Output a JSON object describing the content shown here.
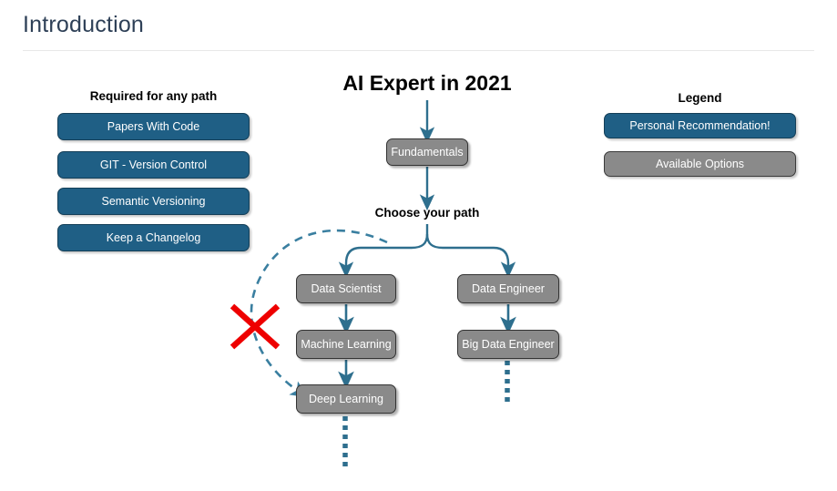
{
  "page": {
    "title": "Introduction"
  },
  "required_section": {
    "heading": "Required for any path",
    "items": [
      {
        "label": "Papers With Code"
      },
      {
        "label": "GIT - Version Control"
      },
      {
        "label": "Semantic Versioning"
      },
      {
        "label": "Keep a Changelog"
      }
    ]
  },
  "legend": {
    "heading": "Legend",
    "items": [
      {
        "label": "Personal Recommendation!",
        "style": "blue",
        "color": "#1f5f85"
      },
      {
        "label": "Available Options",
        "style": "gray",
        "color": "#8a8a8a"
      }
    ]
  },
  "diagram": {
    "title": "AI Expert in 2021",
    "root_node": "Fundamentals",
    "branch_label": "Choose your path",
    "left_branch": [
      {
        "label": "Data Scientist"
      },
      {
        "label": "Machine Learning"
      },
      {
        "label": "Deep Learning"
      }
    ],
    "right_branch": [
      {
        "label": "Data Engineer"
      },
      {
        "label": "Big Data Engineer"
      }
    ],
    "shortcut": {
      "name": "dashed-shortcut-to-deep-learning",
      "marker": "red-x",
      "marker_color": "#ee0000"
    },
    "connector_color": "#2e6f8e"
  }
}
